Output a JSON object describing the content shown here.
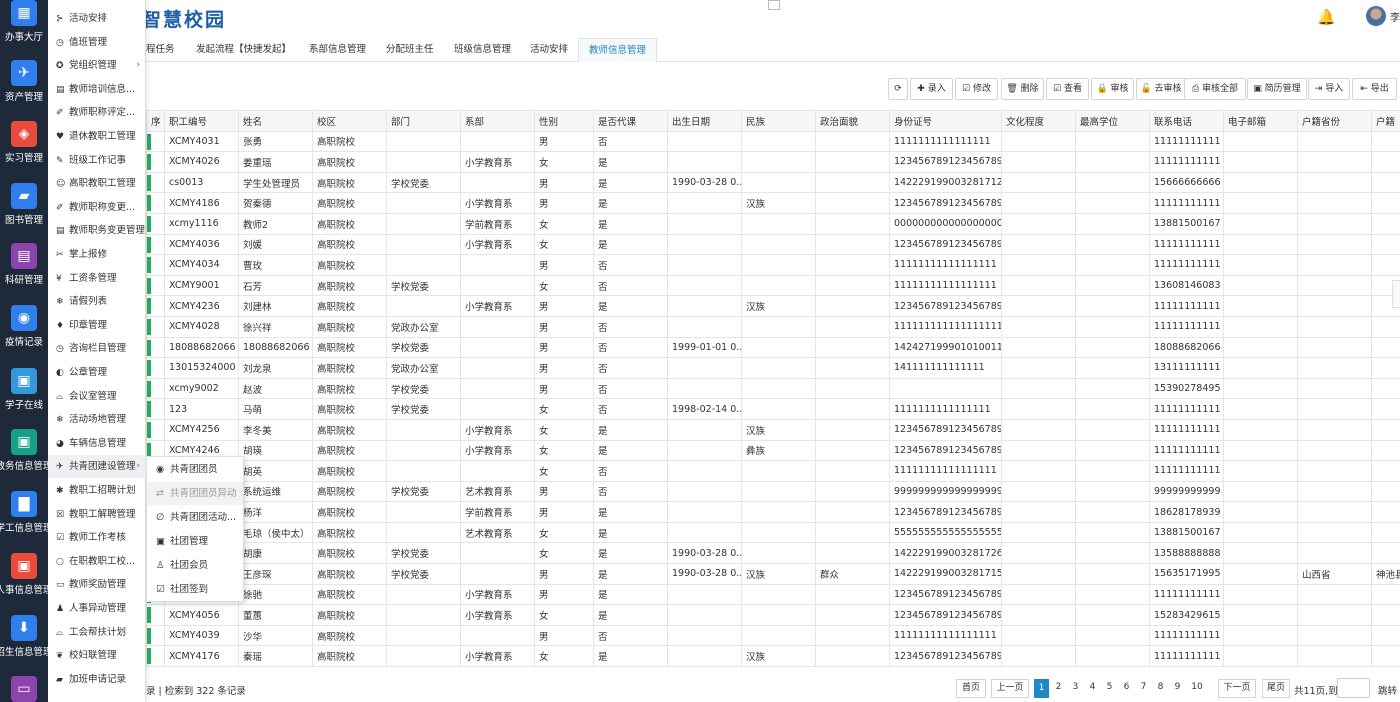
{
  "header": {
    "brand_text": "智慧校园",
    "user_name": "李"
  },
  "leftbar": {
    "items": [
      {
        "label": "办事大厅",
        "icon": "grid-icon",
        "color": "#2f80ed",
        "glyph": "▦"
      },
      {
        "label": "资产管理",
        "icon": "plane-icon",
        "color": "#2f80ed",
        "glyph": "✈"
      },
      {
        "label": "实习管理",
        "icon": "compass-icon",
        "color": "#e74c3c",
        "glyph": "◈"
      },
      {
        "label": "图书管理",
        "icon": "book-icon",
        "color": "#2f80ed",
        "glyph": "▰"
      },
      {
        "label": "科研管理",
        "icon": "clipboard-icon",
        "color": "#8e44ad",
        "glyph": "▤"
      },
      {
        "label": "疫情记录",
        "icon": "circle-icon",
        "color": "#2f80ed",
        "glyph": "◉"
      },
      {
        "label": "学子在线",
        "icon": "id-card-icon",
        "color": "#3498db",
        "glyph": "▣"
      },
      {
        "label": "教务信息管理",
        "icon": "id-card-icon",
        "color": "#16a085",
        "glyph": "▣"
      },
      {
        "label": "学工信息管理",
        "icon": "briefcase-icon",
        "color": "#2f80ed",
        "glyph": "▇"
      },
      {
        "label": "人事信息管理",
        "icon": "id-card-icon",
        "color": "#e74c3c",
        "glyph": "▣"
      },
      {
        "label": "招生信息管理",
        "icon": "download-icon",
        "color": "#2f80ed",
        "glyph": "⬇"
      },
      {
        "label": "",
        "icon": "window-icon",
        "color": "#8e44ad",
        "glyph": "▭"
      }
    ]
  },
  "menu": {
    "items": [
      {
        "label": "活动安排",
        "glyph": "⊱"
      },
      {
        "label": "值班管理",
        "glyph": "◷"
      },
      {
        "label": "党组织管理",
        "glyph": "✪",
        "arrow": "›"
      },
      {
        "label": "教师培训信息...",
        "glyph": "▤"
      },
      {
        "label": "教师职称评定...",
        "glyph": "✐"
      },
      {
        "label": "退休教职工管理",
        "glyph": "♥"
      },
      {
        "label": "班级工作记事",
        "glyph": "✎"
      },
      {
        "label": "高职教职工管理",
        "glyph": "☺"
      },
      {
        "label": "教师职称变更...",
        "glyph": "✐"
      },
      {
        "label": "教师职务变更管理",
        "glyph": "▤"
      },
      {
        "label": "掌上报修",
        "glyph": "✂"
      },
      {
        "label": "工资条管理",
        "glyph": "¥"
      },
      {
        "label": "请假列表",
        "glyph": "❄"
      },
      {
        "label": "印章管理",
        "glyph": "♦"
      },
      {
        "label": "咨询栏目管理",
        "glyph": "◷"
      },
      {
        "label": "公章管理",
        "glyph": "◐"
      },
      {
        "label": "会议室管理",
        "glyph": "⌓"
      },
      {
        "label": "活动场地管理",
        "glyph": "❄"
      },
      {
        "label": "车辆信息管理",
        "glyph": "◕"
      },
      {
        "label": "共青团建设管理",
        "glyph": "✈",
        "arrow": "›",
        "active": true
      },
      {
        "label": "教职工招聘计划",
        "glyph": "✱"
      },
      {
        "label": "教职工解聘管理",
        "glyph": "☒"
      },
      {
        "label": "教师工作考核",
        "glyph": "☑"
      },
      {
        "label": "在职教职工校...",
        "glyph": "○"
      },
      {
        "label": "教师奖励管理",
        "glyph": "▭"
      },
      {
        "label": "人事异动管理",
        "glyph": "♟"
      },
      {
        "label": "工会帮扶计划",
        "glyph": "⌓"
      },
      {
        "label": "校妇联管理",
        "glyph": "❦"
      },
      {
        "label": "加班申请记录",
        "glyph": "▰"
      }
    ]
  },
  "submenu": {
    "items": [
      {
        "label": "共青团团员",
        "glyph": "◉"
      },
      {
        "label": "共青团团员异动",
        "glyph": "⇄",
        "hover": true
      },
      {
        "label": "共青团团活动...",
        "glyph": "∅"
      },
      {
        "label": "社团管理",
        "glyph": "▣"
      },
      {
        "label": "社团会员",
        "glyph": "♙"
      },
      {
        "label": "社团签到",
        "glyph": "☑"
      }
    ]
  },
  "tabs": [
    {
      "label": "程任务"
    },
    {
      "label": "发起流程【快捷发起】"
    },
    {
      "label": "系部信息管理"
    },
    {
      "label": "分配班主任"
    },
    {
      "label": "班级信息管理"
    },
    {
      "label": "活动安排"
    },
    {
      "label": "教师信息管理",
      "active": true
    }
  ],
  "toolbar": {
    "buttons": [
      {
        "label": "⟳"
      },
      {
        "label": "✚ 录入"
      },
      {
        "label": "☑ 修改"
      },
      {
        "label": "🗑 删除"
      },
      {
        "label": "☑ 查看"
      },
      {
        "label": "🔒 审核"
      },
      {
        "label": "🔓 去审核"
      },
      {
        "label": "⎙ 审核全部"
      },
      {
        "label": "▣ 简历管理"
      },
      {
        "label": "⇥ 导入"
      },
      {
        "label": "⇤ 导出"
      }
    ]
  },
  "table": {
    "columns": [
      "序",
      "职工编号",
      "姓名",
      "校区",
      "部门",
      "系部",
      "性别",
      "是否代课",
      "出生日期",
      "民族",
      "政治面貌",
      "身份证号",
      "文化程度",
      "最高学位",
      "联系电话",
      "电子邮箱",
      "户籍省份",
      "户籍"
    ],
    "rows": [
      [
        "",
        "XCMY4031",
        "张勇",
        "高职院校",
        "",
        "",
        "男",
        "否",
        "",
        "",
        "",
        "1111111111111111",
        "",
        "",
        "11111111111",
        "",
        "",
        ""
      ],
      [
        "",
        "XCMY4026",
        "姜重瑶",
        "高职院校",
        "",
        "小学教育系",
        "女",
        "是",
        "",
        "",
        "",
        "123456789123456789",
        "",
        "",
        "11111111111",
        "",
        "",
        ""
      ],
      [
        "",
        "cs0013",
        "学生处管理员",
        "高职院校",
        "学校党委",
        "",
        "男",
        "是",
        "1990-03-28 0...",
        "",
        "",
        "142229199003281712",
        "",
        "",
        "15666666666",
        "",
        "",
        ""
      ],
      [
        "",
        "XCMY4186",
        "贺秦德",
        "高职院校",
        "",
        "小学教育系",
        "男",
        "是",
        "",
        "汉族",
        "",
        "123456789123456789",
        "",
        "",
        "11111111111",
        "",
        "",
        ""
      ],
      [
        "",
        "xcmy1116",
        "教师2",
        "高职院校",
        "",
        "学前教育系",
        "女",
        "是",
        "",
        "",
        "",
        "000000000000000000",
        "",
        "",
        "13881500167",
        "",
        "",
        ""
      ],
      [
        "",
        "XCMY4036",
        "刘媛",
        "高职院校",
        "",
        "小学教育系",
        "女",
        "是",
        "",
        "",
        "",
        "123456789123456789",
        "",
        "",
        "11111111111",
        "",
        "",
        ""
      ],
      [
        "",
        "XCMY4034",
        "曹玫",
        "高职院校",
        "",
        "",
        "男",
        "否",
        "",
        "",
        "",
        "11111111111111111",
        "",
        "",
        "11111111111",
        "",
        "",
        ""
      ],
      [
        "",
        "XCMY9001",
        "石芳",
        "高职院校",
        "学校党委",
        "",
        "女",
        "否",
        "",
        "",
        "",
        "11111111111111111",
        "",
        "",
        "13608146083",
        "",
        "",
        ""
      ],
      [
        "",
        "XCMY4236",
        "刘建林",
        "高职院校",
        "",
        "小学教育系",
        "男",
        "是",
        "",
        "汉族",
        "",
        "123456789123456789",
        "",
        "",
        "11111111111",
        "",
        "",
        ""
      ],
      [
        "",
        "XCMY4028",
        "徐兴祥",
        "高职院校",
        "党政办公室",
        "",
        "男",
        "否",
        "",
        "",
        "",
        "111111111111111111",
        "",
        "",
        "11111111111",
        "",
        "",
        ""
      ],
      [
        "",
        "18088682066",
        "18088682066",
        "高职院校",
        "学校党委",
        "",
        "男",
        "否",
        "1999-01-01 0...",
        "",
        "",
        "142427199901010011",
        "",
        "",
        "18088682066",
        "",
        "",
        ""
      ],
      [
        "",
        "13015324000",
        "刘龙泉",
        "高职院校",
        "党政办公室",
        "",
        "男",
        "否",
        "",
        "",
        "",
        "141111111111111",
        "",
        "",
        "13111111111",
        "",
        "",
        ""
      ],
      [
        "",
        "xcmy9002",
        "赵波",
        "高职院校",
        "学校党委",
        "",
        "男",
        "否",
        "",
        "",
        "",
        "",
        "",
        "",
        "15390278495",
        "",
        "",
        ""
      ],
      [
        "",
        "123",
        "马萌",
        "高职院校",
        "学校党委",
        "",
        "女",
        "否",
        "1998-02-14 0...",
        "",
        "",
        "1111111111111111",
        "",
        "",
        "11111111111",
        "",
        "",
        ""
      ],
      [
        "",
        "XCMY4256",
        "李冬美",
        "高职院校",
        "",
        "小学教育系",
        "女",
        "是",
        "",
        "汉族",
        "",
        "123456789123456789",
        "",
        "",
        "11111111111",
        "",
        "",
        ""
      ],
      [
        "",
        "XCMY4246",
        "胡瑛",
        "高职院校",
        "",
        "小学教育系",
        "女",
        "是",
        "",
        "彝族",
        "",
        "123456789123456789",
        "",
        "",
        "11111111111",
        "",
        "",
        ""
      ],
      [
        "",
        "",
        "胡英",
        "高职院校",
        "",
        "",
        "女",
        "否",
        "",
        "",
        "",
        "11111111111111111",
        "",
        "",
        "11111111111",
        "",
        "",
        ""
      ],
      [
        "",
        "",
        "系统运维",
        "高职院校",
        "学校党委",
        "艺术教育系",
        "男",
        "否",
        "",
        "",
        "",
        "999999999999999999",
        "",
        "",
        "99999999999",
        "",
        "",
        ""
      ],
      [
        "",
        "",
        "杨洋",
        "高职院校",
        "",
        "学前教育系",
        "男",
        "是",
        "",
        "",
        "",
        "123456789123456789",
        "",
        "",
        "18628178939",
        "",
        "",
        ""
      ],
      [
        "",
        "",
        "毛琼（侯中太）",
        "高职院校",
        "",
        "艺术教育系",
        "女",
        "是",
        "",
        "",
        "",
        "555555555555555555...",
        "",
        "",
        "13881500167",
        "",
        "",
        ""
      ],
      [
        "",
        "",
        "胡康",
        "高职院校",
        "学校党委",
        "",
        "女",
        "是",
        "1990-03-28 0...",
        "",
        "",
        "142229199003281726",
        "",
        "",
        "13588888888",
        "",
        "",
        ""
      ],
      [
        "",
        "",
        "王彦琛",
        "高职院校",
        "学校党委",
        "",
        "男",
        "是",
        "1990-03-28 0...",
        "汉族",
        "群众",
        "142229199003281715",
        "",
        "",
        "15635171995",
        "",
        "山西省",
        "神池县"
      ],
      [
        "",
        "",
        "徐驰",
        "高职院校",
        "",
        "小学教育系",
        "男",
        "是",
        "",
        "",
        "",
        "123456789123456789",
        "",
        "",
        "11111111111",
        "",
        "",
        ""
      ],
      [
        "",
        "XCMY4056",
        "董蕙",
        "高职院校",
        "",
        "小学教育系",
        "女",
        "是",
        "",
        "",
        "",
        "123456789123456789",
        "",
        "",
        "15283429615",
        "",
        "",
        ""
      ],
      [
        "",
        "XCMY4039",
        "沙华",
        "高职院校",
        "",
        "",
        "男",
        "否",
        "",
        "",
        "",
        "11111111111111111",
        "",
        "",
        "11111111111",
        "",
        "",
        ""
      ],
      [
        "",
        "XCMY4176",
        "秦瑶",
        "高职院校",
        "",
        "小学教育系",
        "女",
        "是",
        "",
        "汉族",
        "",
        "123456789123456789",
        "",
        "",
        "11111111111",
        "",
        "",
        ""
      ]
    ]
  },
  "footer": {
    "info": "录 | 检索到 322 条记录",
    "first": "首页",
    "prev": "上一页",
    "pages": [
      "1",
      "2",
      "3",
      "4",
      "5",
      "6",
      "7",
      "8",
      "9",
      "10"
    ],
    "next": "下一页",
    "last": "尾页",
    "total": "共11页,到",
    "jump": "跳转"
  }
}
